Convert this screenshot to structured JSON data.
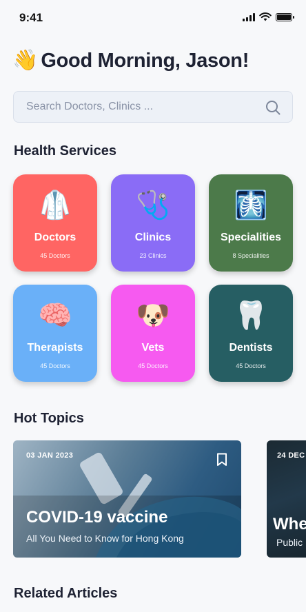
{
  "status_bar": {
    "time": "9:41"
  },
  "greeting": {
    "emoji": "👋",
    "text": "Good Morning, Jason!"
  },
  "search": {
    "placeholder": "Search Doctors, Clinics ..."
  },
  "sections": {
    "health_services": "Health Services",
    "hot_topics": "Hot Topics",
    "related_articles": "Related Articles"
  },
  "services": [
    {
      "label": "Doctors",
      "sub": "45 Doctors",
      "emoji": "🥼",
      "color": "#FF6563"
    },
    {
      "label": "Clinics",
      "sub": "23 Clinics",
      "emoji": "🩺",
      "color": "#8A6CF6"
    },
    {
      "label": "Specialities",
      "sub": "8 Specialities",
      "emoji": "🩻",
      "color": "#4C7A4A"
    },
    {
      "label": "Therapists",
      "sub": "45 Doctors",
      "emoji": "🧠",
      "color": "#6AB0F8"
    },
    {
      "label": "Vets",
      "sub": "45 Doctors",
      "emoji": "🐶",
      "color": "#F65AF0"
    },
    {
      "label": "Dentists",
      "sub": "45 Doctors",
      "emoji": "🦷",
      "color": "#265E63"
    }
  ],
  "topics": [
    {
      "date": "03 JAN 2023",
      "title": "COVID-19 vaccine",
      "subtitle": "All You Need to Know for Hong Kong"
    },
    {
      "date": "24 DEC",
      "title": "Whe",
      "subtitle": "Public"
    }
  ]
}
